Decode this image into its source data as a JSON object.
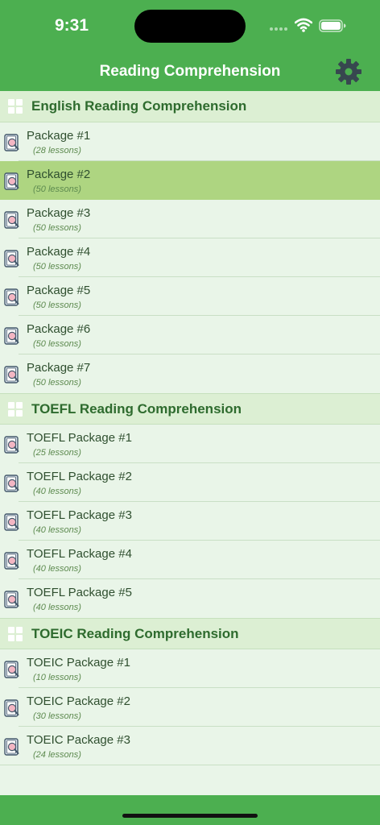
{
  "status": {
    "time": "9:31"
  },
  "nav": {
    "title": "Reading Comprehension"
  },
  "sections": [
    {
      "title": "English Reading Comprehension",
      "items": [
        {
          "title": "Package #1",
          "sub": "(28 lessons)"
        },
        {
          "title": "Package #2",
          "sub": "(50 lessons)"
        },
        {
          "title": "Package #3",
          "sub": "(50 lessons)"
        },
        {
          "title": "Package #4",
          "sub": "(50 lessons)"
        },
        {
          "title": "Package #5",
          "sub": "(50 lessons)"
        },
        {
          "title": "Package #6",
          "sub": "(50 lessons)"
        },
        {
          "title": "Package #7",
          "sub": "(50 lessons)"
        }
      ]
    },
    {
      "title": "TOEFL Reading Comprehension",
      "items": [
        {
          "title": "TOEFL Package #1",
          "sub": "(25 lessons)"
        },
        {
          "title": "TOEFL Package #2",
          "sub": "(40 lessons)"
        },
        {
          "title": "TOEFL Package #3",
          "sub": "(40 lessons)"
        },
        {
          "title": "TOEFL Package #4",
          "sub": "(40 lessons)"
        },
        {
          "title": "TOEFL Package #5",
          "sub": "(40 lessons)"
        }
      ]
    },
    {
      "title": "TOEIC Reading Comprehension",
      "items": [
        {
          "title": "TOEIC Package #1",
          "sub": "(10 lessons)"
        },
        {
          "title": "TOEIC Package #2",
          "sub": "(30 lessons)"
        },
        {
          "title": "TOEIC Package #3",
          "sub": "(24 lessons)"
        }
      ]
    }
  ],
  "icons": {
    "status": [
      "cellular-signal-icon",
      "wifi-icon",
      "battery-icon"
    ],
    "nav_action": "gear-icon",
    "section": "grid-icon",
    "row": "book-icon"
  },
  "colors": {
    "primary": "#4caf50",
    "background": "#e9f5e8",
    "section_header": "#dcefd3",
    "selected_row": "#aed581",
    "section_title": "#2e6b2e",
    "row_subtitle": "#5d8a4f"
  }
}
